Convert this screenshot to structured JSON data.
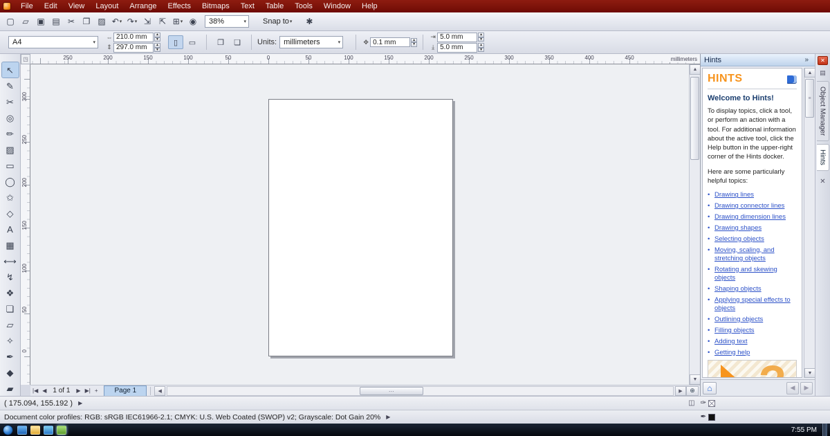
{
  "colors": {
    "menubar": "#7c120a",
    "accent_orange": "#f7941e",
    "link_blue": "#2b50c8",
    "page_tab_blue": "#bcd4ef",
    "close_red": "#c23317"
  },
  "menu": {
    "items": [
      "File",
      "Edit",
      "View",
      "Layout",
      "Arrange",
      "Effects",
      "Bitmaps",
      "Text",
      "Table",
      "Tools",
      "Window",
      "Help"
    ]
  },
  "toolbar": {
    "zoom_value": "38%",
    "snap_label": "Snap to",
    "icons_left": [
      {
        "name": "new-document-icon",
        "glyph": "▢"
      },
      {
        "name": "open-icon",
        "glyph": "▱"
      },
      {
        "name": "save-icon",
        "glyph": "▣"
      },
      {
        "name": "print-icon",
        "glyph": "▤"
      },
      {
        "name": "cut-icon",
        "glyph": "✂"
      },
      {
        "name": "copy-icon",
        "glyph": "❐"
      },
      {
        "name": "paste-icon",
        "glyph": "▨"
      },
      {
        "name": "undo-icon",
        "glyph": "↶",
        "dropdown": true
      },
      {
        "name": "redo-icon",
        "glyph": "↷",
        "dropdown": true
      },
      {
        "name": "import-icon",
        "glyph": "⇲"
      },
      {
        "name": "export-icon",
        "glyph": "⇱"
      },
      {
        "name": "application-launcher-icon",
        "glyph": "⊞",
        "dropdown": true
      },
      {
        "name": "corel-connect-icon",
        "glyph": "◉"
      }
    ],
    "icons_right": [
      {
        "name": "options-gear-icon",
        "glyph": "✱"
      }
    ]
  },
  "property_bar": {
    "page_size": "A4",
    "page_width": "210.0 mm",
    "page_height": "297.0 mm",
    "units_label": "Units:",
    "units_value": "millimeters",
    "nudge_offset": "0.1 mm",
    "duplicate_x": "5.0 mm",
    "duplicate_y": "5.0 mm"
  },
  "ruler": {
    "h_ticks": [
      "250",
      "200",
      "150",
      "100",
      "50",
      "0",
      "50",
      "100",
      "150",
      "200",
      "250",
      "300",
      "350",
      "400",
      "450"
    ],
    "unit_label": "millimeters",
    "v_ticks": [
      "300",
      "250",
      "200",
      "150",
      "100",
      "50",
      "0"
    ],
    "v_unit_label": "millimeters"
  },
  "toolbox": {
    "tools": [
      {
        "name": "pick-tool",
        "glyph": "↖"
      },
      {
        "name": "shape-tool",
        "glyph": "✎"
      },
      {
        "name": "crop-tool",
        "glyph": "✂"
      },
      {
        "name": "zoom-tool",
        "glyph": "◎"
      },
      {
        "name": "freehand-tool",
        "glyph": "✏"
      },
      {
        "name": "smart-fill-tool",
        "glyph": "▨"
      },
      {
        "name": "rectangle-tool",
        "glyph": "▭"
      },
      {
        "name": "ellipse-tool",
        "glyph": "◯"
      },
      {
        "name": "polygon-tool",
        "glyph": "✩"
      },
      {
        "name": "basic-shapes-tool",
        "glyph": "◇"
      },
      {
        "name": "text-tool",
        "glyph": "A"
      },
      {
        "name": "table-tool",
        "glyph": "▦"
      },
      {
        "name": "parallel-dimension-tool",
        "glyph": "⟷"
      },
      {
        "name": "straight-line-connector-tool",
        "glyph": "↯"
      },
      {
        "name": "blend-tool",
        "glyph": "❖"
      },
      {
        "name": "drop-shadow-tool",
        "glyph": "❏"
      },
      {
        "name": "transparency-tool",
        "glyph": "▱"
      },
      {
        "name": "color-eyedropper-tool",
        "glyph": "✧"
      },
      {
        "name": "outline-pen-tool",
        "glyph": "✒"
      },
      {
        "name": "fill-tool",
        "glyph": "◆"
      },
      {
        "name": "interactive-fill-tool",
        "glyph": "▰"
      }
    ]
  },
  "hints": {
    "title": "Hints",
    "heading": "HINTS",
    "welcome": "Welcome to Hints!",
    "intro": "To display topics, click a tool, or perform an action with a tool. For additional information about the active tool, click the Help button in the upper-right corner of the Hints docker.",
    "topics_intro": "Here are some particularly helpful topics:",
    "links": [
      "Drawing lines",
      "Drawing connector lines",
      "Drawing dimension lines",
      "Drawing shapes",
      "Selecting objects",
      "Moving, scaling, and stretching objects",
      "Rotating and skewing objects",
      "Shaping objects",
      "Applying special effects to objects",
      "Outlining objects",
      "Filling objects",
      "Adding text",
      "Getting help"
    ]
  },
  "docker_tabs": {
    "tabs": [
      "Object Manager",
      "Hints"
    ],
    "active": "Hints"
  },
  "navigation": {
    "page_indicator": "1 of 1",
    "page_tab": "Page 1"
  },
  "status": {
    "coordinates": "( 175.094, 155.192 )",
    "document_profiles": "Document color profiles: RGB: sRGB IEC61966-2.1; CMYK: U.S. Web Coated (SWOP) v2; Grayscale: Dot Gain 20%"
  },
  "taskbar": {
    "time": "7:55 PM"
  }
}
